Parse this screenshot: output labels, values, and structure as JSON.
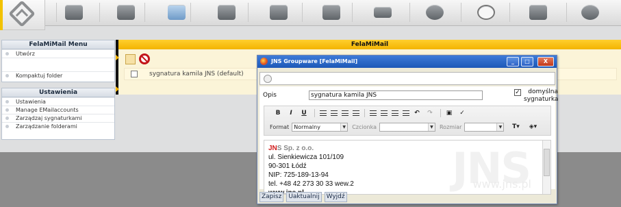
{
  "top_toolbar": {
    "icons": [
      "home-logo-icon",
      "dashboard-icon",
      "home-icon",
      "mail-icon",
      "calendar-icon",
      "contacts-icon",
      "tasks-icon",
      "projects-icon",
      "infolog-icon",
      "timesheet-icon",
      "files-icon",
      "search-icon"
    ]
  },
  "menu_panel": {
    "title": "FelaMiMail Menu",
    "items": [
      "Utwórz",
      "",
      "Kompaktuj folder"
    ]
  },
  "settings_panel": {
    "title": "Ustawienia",
    "items": [
      "Ustawienia",
      "Manage EMailaccounts",
      "Zarządzaj sygnaturkami",
      "Zarządzanie folderami"
    ]
  },
  "main": {
    "title": "FelaMiMail",
    "row_label": "sygnatura kamila JNS (default)"
  },
  "dialog": {
    "title": "JNS Groupware [FelaMiMail]",
    "window_buttons": [
      "_",
      "□",
      "X"
    ],
    "opis_label": "Opis",
    "opis_value": "sygnatura kamila JNS",
    "default_checked": true,
    "default_label": "domyślna sygnaturka",
    "toolbar": {
      "format_label": "Format",
      "format_value": "Normalny",
      "font_label": "Czcionka",
      "font_value": "",
      "size_label": "Rozmiar",
      "size_value": ""
    },
    "signature": {
      "company_jn": "JN",
      "company_rest": "S Sp. z o.o.",
      "street": "ul. Sienkiewicza 101/109",
      "city": "90-301 Łódź",
      "nip": "NIP: 725-189-13-94",
      "tel": "tel. +48 42 273 30 33 wew.2",
      "web": "www.jns.pl"
    },
    "watermark": "JNS",
    "watermark_url": "www.jns.pl",
    "footer_buttons": [
      "Zapisz",
      "Uaktualnij",
      "Wyjdź"
    ]
  }
}
